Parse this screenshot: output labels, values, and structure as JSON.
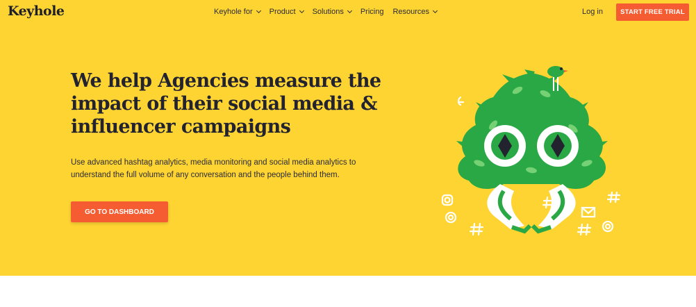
{
  "brand": {
    "logo_text": "Keyhole"
  },
  "nav": {
    "links": [
      {
        "label": "Keyhole for",
        "dropdown": true
      },
      {
        "label": "Product",
        "dropdown": true
      },
      {
        "label": "Solutions",
        "dropdown": true
      },
      {
        "label": "Pricing",
        "dropdown": false
      },
      {
        "label": "Resources",
        "dropdown": true
      }
    ],
    "login_label": "Log in",
    "trial_label": "START FREE TRIAL"
  },
  "hero": {
    "headline": "We help Agencies measure the impact of their social media & influencer campaigns",
    "subtext": "Use advanced hashtag analytics, media monitoring and social media analytics to understand the full volume of any conversation and the people behind them.",
    "cta_label": "GO TO DASHBOARD"
  },
  "colors": {
    "hero_bg": "#fed432",
    "accent": "#f55c32",
    "text": "#23232f",
    "illustration_green": "#29a845"
  },
  "icons": [
    "chevron-down-icon",
    "instagram-icon",
    "at-sign-icon",
    "hashtag-icon",
    "mail-icon",
    "bird-icon"
  ]
}
